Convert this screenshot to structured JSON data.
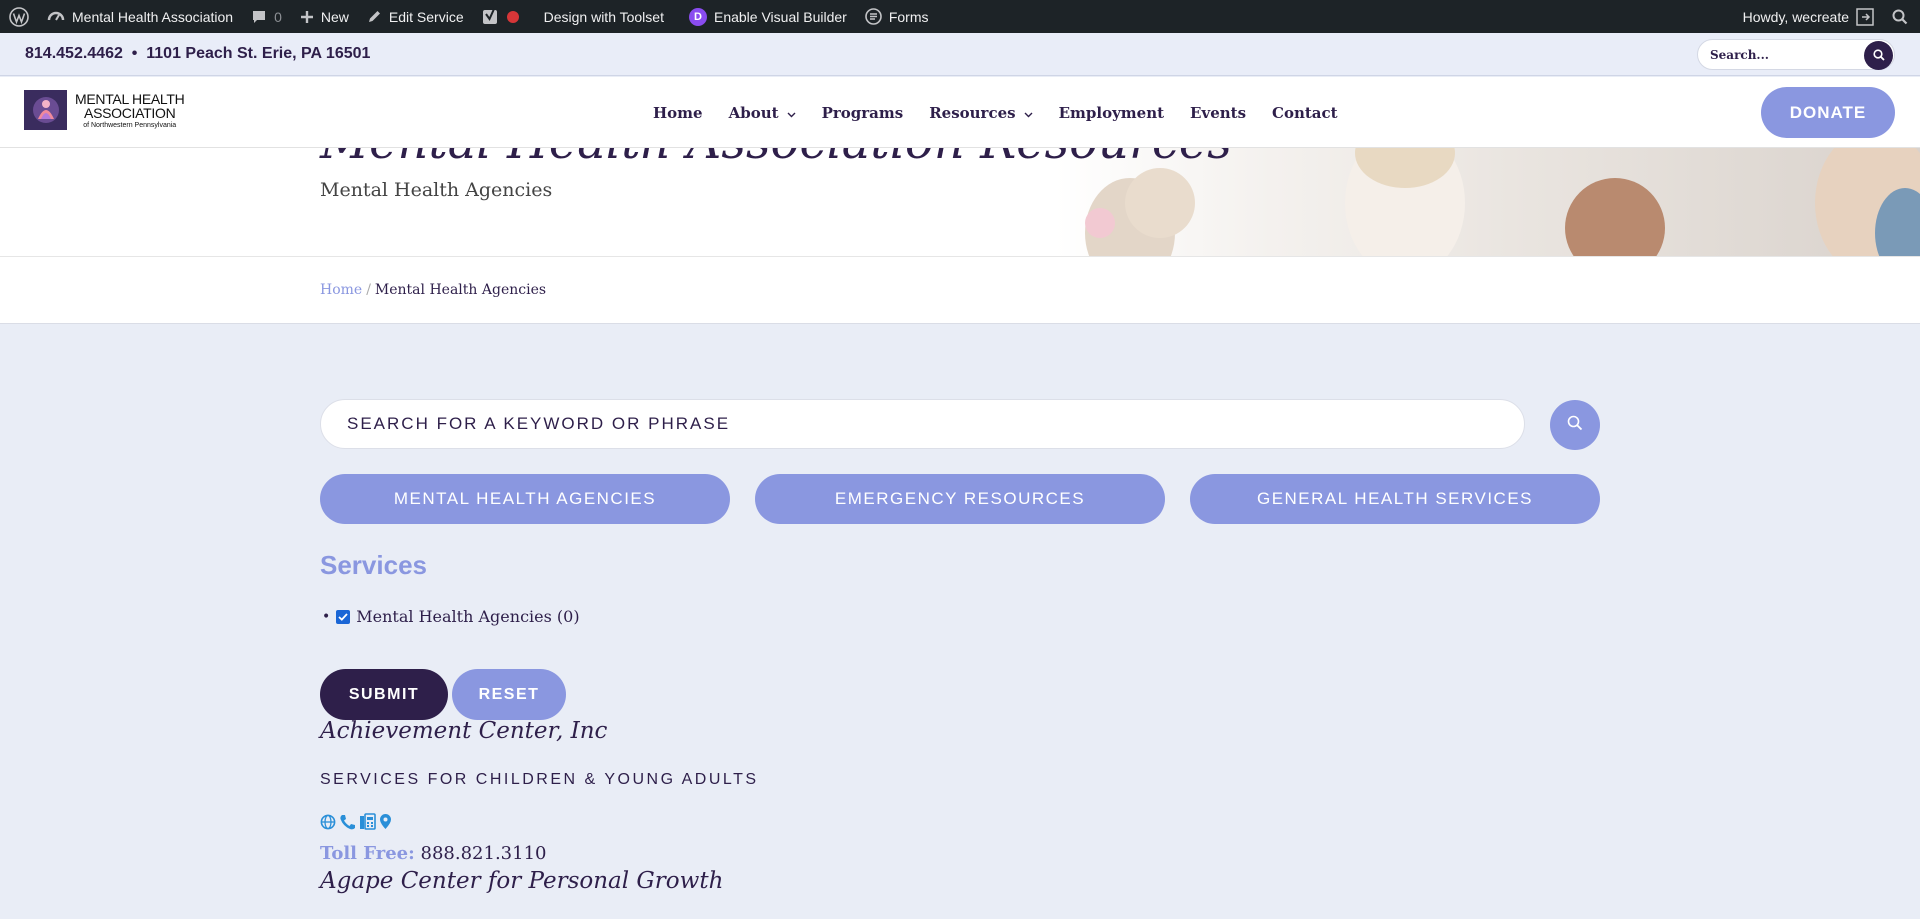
{
  "admin_bar": {
    "site_name": "Mental Health Association",
    "comments_count": "0",
    "new_label": "New",
    "edit_label": "Edit Service",
    "toolset_label": "Design with Toolset",
    "divi_letter": "D",
    "visual_builder_label": "Enable Visual Builder",
    "forms_label": "Forms",
    "greeting": "Howdy, wecreate"
  },
  "topbar": {
    "contact": "814.452.4462  •  1101 Peach St. Erie, PA 16501",
    "search_placeholder": "Search..."
  },
  "header": {
    "logo_line1": "MENTAL HEALTH",
    "logo_line2": "ASSOCIATION",
    "logo_line3": "of Northwestern Pennsylvania",
    "nav": {
      "home": "Home",
      "about": "About",
      "programs": "Programs",
      "resources": "Resources",
      "employment": "Employment",
      "events": "Events",
      "contact": "Contact"
    },
    "donate_label": "DONATE"
  },
  "hero": {
    "title": "Mental Health Association Resources",
    "subtitle": "Mental Health Agencies"
  },
  "breadcrumb": {
    "home": "Home",
    "separator": "/",
    "current": "Mental Health Agencies"
  },
  "search": {
    "placeholder": "SEARCH FOR A KEYWORD OR PHRASE"
  },
  "categories": {
    "mental": "MENTAL HEALTH AGENCIES",
    "emergency": "EMERGENCY RESOURCES",
    "general": "GENERAL HEALTH SERVICES"
  },
  "filters": {
    "heading": "Services",
    "bullet": "•",
    "item_label": "Mental Health Agencies (0)",
    "item_checked": true,
    "submit_label": "SUBMIT",
    "reset_label": "RESET"
  },
  "results": {
    "first": {
      "name": "Achievement Center, Inc",
      "category": "SERVICES FOR CHILDREN & YOUNG ADULTS",
      "icons": [
        "globe-icon",
        "phone-icon",
        "fax-icon",
        "map-pin-icon"
      ],
      "phone_label": "Toll Free:",
      "phone": "888.821.3110"
    },
    "second": {
      "name": "Agape Center for Personal Growth"
    }
  },
  "colors": {
    "accent": "#8a97e0",
    "primary": "#2e1f4a",
    "admin_bar": "#1d2327",
    "icon_blue": "#2a8fd8"
  }
}
